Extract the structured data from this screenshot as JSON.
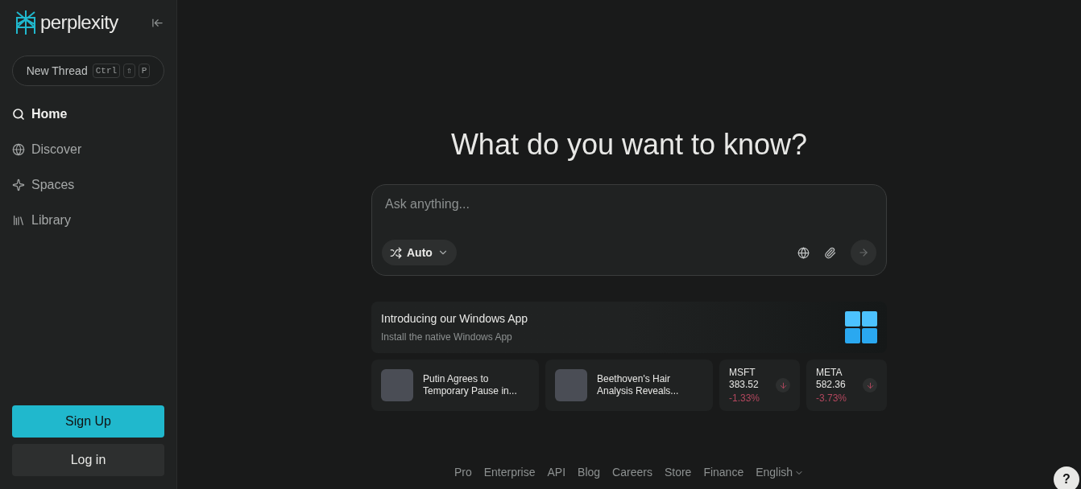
{
  "sidebar": {
    "logo": "perplexity",
    "new_thread": {
      "label": "New Thread",
      "keys": [
        "Ctrl",
        "⇧",
        "P"
      ]
    },
    "nav": [
      {
        "label": "Home",
        "selected": true,
        "kind": "home"
      },
      {
        "label": "Discover",
        "selected": false,
        "kind": "discover"
      },
      {
        "label": "Spaces",
        "selected": false,
        "kind": "spaces"
      },
      {
        "label": "Library",
        "selected": false,
        "kind": "library"
      }
    ],
    "sign_up": "Sign Up",
    "log_in": "Log in"
  },
  "main": {
    "heading": "What do you want to know?",
    "search": {
      "placeholder": "Ask anything...",
      "mode": "Auto"
    },
    "promo": {
      "title": "Introducing our Windows App",
      "subtitle": "Install the native Windows App"
    },
    "news": [
      {
        "title": "Putin Agrees to Temporary Pause in..."
      },
      {
        "title": "Beethoven's Hair Analysis Reveals..."
      }
    ],
    "stocks": [
      {
        "ticker": "MSFT",
        "price": "383.52",
        "change": "-1.33%"
      },
      {
        "ticker": "META",
        "price": "582.36",
        "change": "-3.73%"
      }
    ],
    "footer": [
      "Pro",
      "Enterprise",
      "API",
      "Blog",
      "Careers",
      "Store",
      "Finance"
    ],
    "language": "English",
    "help": "?"
  }
}
